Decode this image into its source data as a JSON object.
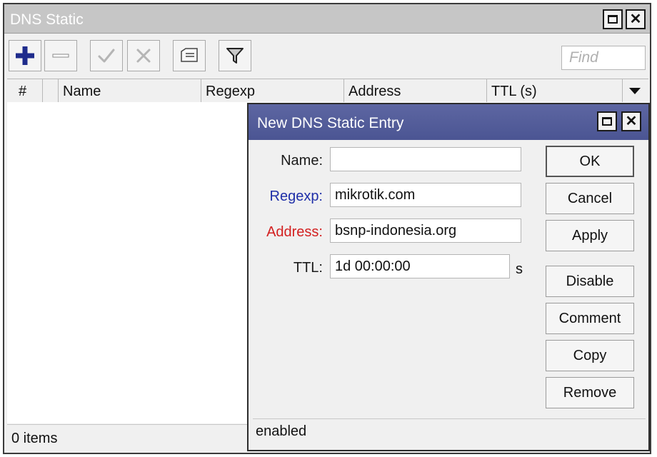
{
  "window": {
    "title": "DNS Static"
  },
  "toolbar": {
    "buttons": [
      {
        "icon": "add-icon"
      },
      {
        "icon": "remove-icon"
      },
      {
        "icon": "enable-icon"
      },
      {
        "icon": "disable-icon"
      },
      {
        "icon": "comment-icon"
      },
      {
        "icon": "filter-icon"
      }
    ],
    "find_placeholder": "Find"
  },
  "table": {
    "columns": [
      "#",
      "",
      "Name",
      "Regexp",
      "Address",
      "TTL (s)"
    ],
    "rows": []
  },
  "status": {
    "count": "0 items"
  },
  "dialog": {
    "title": "New DNS Static Entry",
    "fields": [
      {
        "label": "Name:",
        "value": "",
        "label_color": "#1a1a1a"
      },
      {
        "label": "Regexp:",
        "value": "mikrotik.com",
        "label_color": "#1f2fa8"
      },
      {
        "label": "Address:",
        "value": "bsnp-indonesia.org",
        "label_color": "#d32020"
      },
      {
        "label": "TTL:",
        "value": "1d 00:00:00",
        "label_color": "#1a1a1a",
        "unit": "s"
      }
    ],
    "buttons": [
      "OK",
      "Cancel",
      "Apply",
      "Disable",
      "Comment",
      "Copy",
      "Remove"
    ],
    "status": "enabled"
  },
  "colors": {
    "dialog_titlebar": "#4f5996",
    "add_icon": "#1f2c8c",
    "regexp_label": "#1f2fa8",
    "address_label": "#d32020"
  }
}
